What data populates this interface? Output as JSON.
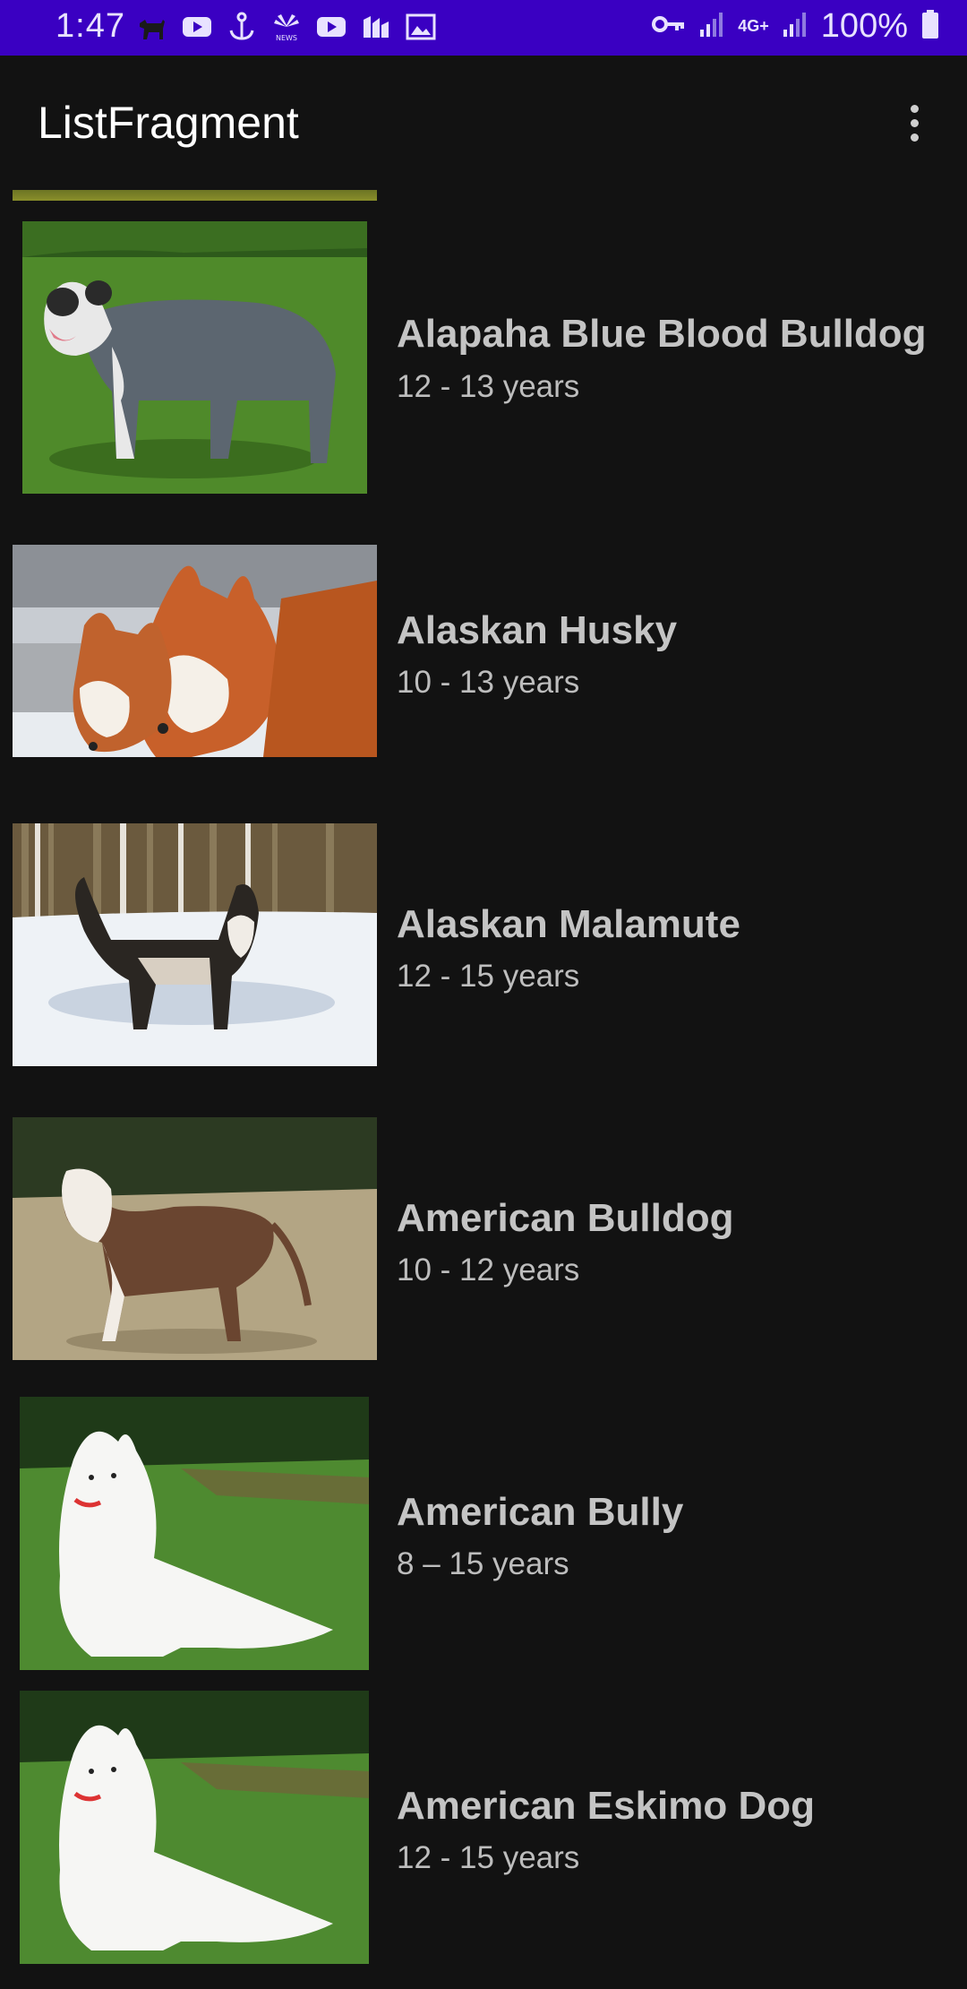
{
  "status_bar": {
    "time": "1:47",
    "battery": "100%",
    "network": "4G+",
    "icons": [
      "dog-app-icon",
      "youtube-icon",
      "anchor-icon",
      "nbc-news-icon",
      "youtube-icon",
      "chart-app-icon",
      "gallery-icon",
      "vpn-key-icon",
      "signal-icon",
      "signal-icon",
      "battery-icon"
    ]
  },
  "app_bar": {
    "title": "ListFragment",
    "menu_icon": "more-vert-icon"
  },
  "breeds": [
    {
      "name": "Alapaha Blue Blood Bulldog",
      "life_span": "12 - 13 years"
    },
    {
      "name": "Alaskan Husky",
      "life_span": "10 - 13 years"
    },
    {
      "name": "Alaskan Malamute",
      "life_span": "12 - 15 years"
    },
    {
      "name": "American Bulldog",
      "life_span": "10 - 12 years"
    },
    {
      "name": "American Bully",
      "life_span": "8 – 15 years"
    },
    {
      "name": "American Eskimo Dog",
      "life_span": "12 - 15 years"
    }
  ],
  "colors": {
    "status_bar": "#3a00c2",
    "background": "#121212",
    "title": "#ffffff",
    "item_text": "#c4c4c4"
  }
}
